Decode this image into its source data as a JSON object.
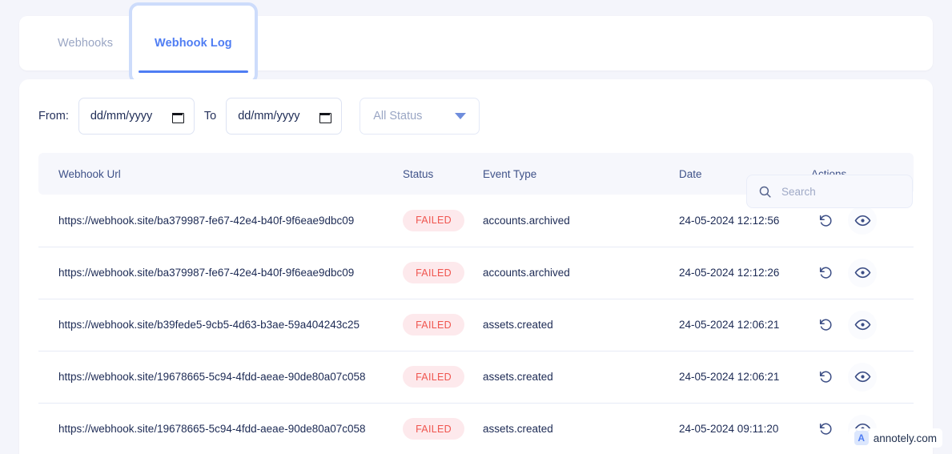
{
  "tabs": [
    {
      "label": "Webhooks",
      "active": false
    },
    {
      "label": "Webhook Log",
      "active": true
    }
  ],
  "filters": {
    "from_label": "From:",
    "to_label": "To",
    "from_date_placeholder": "dd/mm/yyyy",
    "to_date_placeholder": "dd/mm/yyyy",
    "from_date_value": "",
    "to_date_value": "",
    "status_selected": "All Status",
    "status_options": [
      "All Status"
    ]
  },
  "search": {
    "placeholder": "Search",
    "value": ""
  },
  "table": {
    "columns": [
      "Webhook Url",
      "Status",
      "Event Type",
      "Date",
      "Actions"
    ],
    "rows": [
      {
        "url": "https://webhook.site/ba379987-fe67-42e4-b40f-9f6eae9dbc09",
        "status": "FAILED",
        "event_type": "accounts.archived",
        "date": "24-05-2024 12:12:56",
        "actions": [
          "retry-icon",
          "view-icon"
        ]
      },
      {
        "url": "https://webhook.site/ba379987-fe67-42e4-b40f-9f6eae9dbc09",
        "status": "FAILED",
        "event_type": "accounts.archived",
        "date": "24-05-2024 12:12:26",
        "actions": [
          "retry-icon",
          "view-icon"
        ]
      },
      {
        "url": "https://webhook.site/b39fede5-9cb5-4d63-b3ae-59a404243c25",
        "status": "FAILED",
        "event_type": "assets.created",
        "date": "24-05-2024 12:06:21",
        "actions": [
          "retry-icon",
          "view-icon"
        ]
      },
      {
        "url": "https://webhook.site/19678665-5c94-4fdd-aeae-90de80a07c058",
        "status": "FAILED",
        "event_type": "assets.created",
        "date": "24-05-2024 12:06:21",
        "actions": [
          "retry-icon",
          "view-icon"
        ]
      },
      {
        "url": "https://webhook.site/19678665-5c94-4fdd-aeae-90de80a07c058",
        "status": "FAILED",
        "event_type": "assets.created",
        "date": "24-05-2024 09:11:20",
        "actions": [
          "retry-icon",
          "view-icon"
        ]
      }
    ]
  },
  "watermark": {
    "text": "annotely.com",
    "logo_letter": "A"
  },
  "colors": {
    "page_background": "#f4f5fb",
    "accent": "#4f7df3",
    "status_failed_text": "#f0554f",
    "status_failed_background": "#fde9ec",
    "text_primary": "#1c2a54",
    "text_muted": "#9aa6c4",
    "table_header_background": "#f6f7fc"
  }
}
